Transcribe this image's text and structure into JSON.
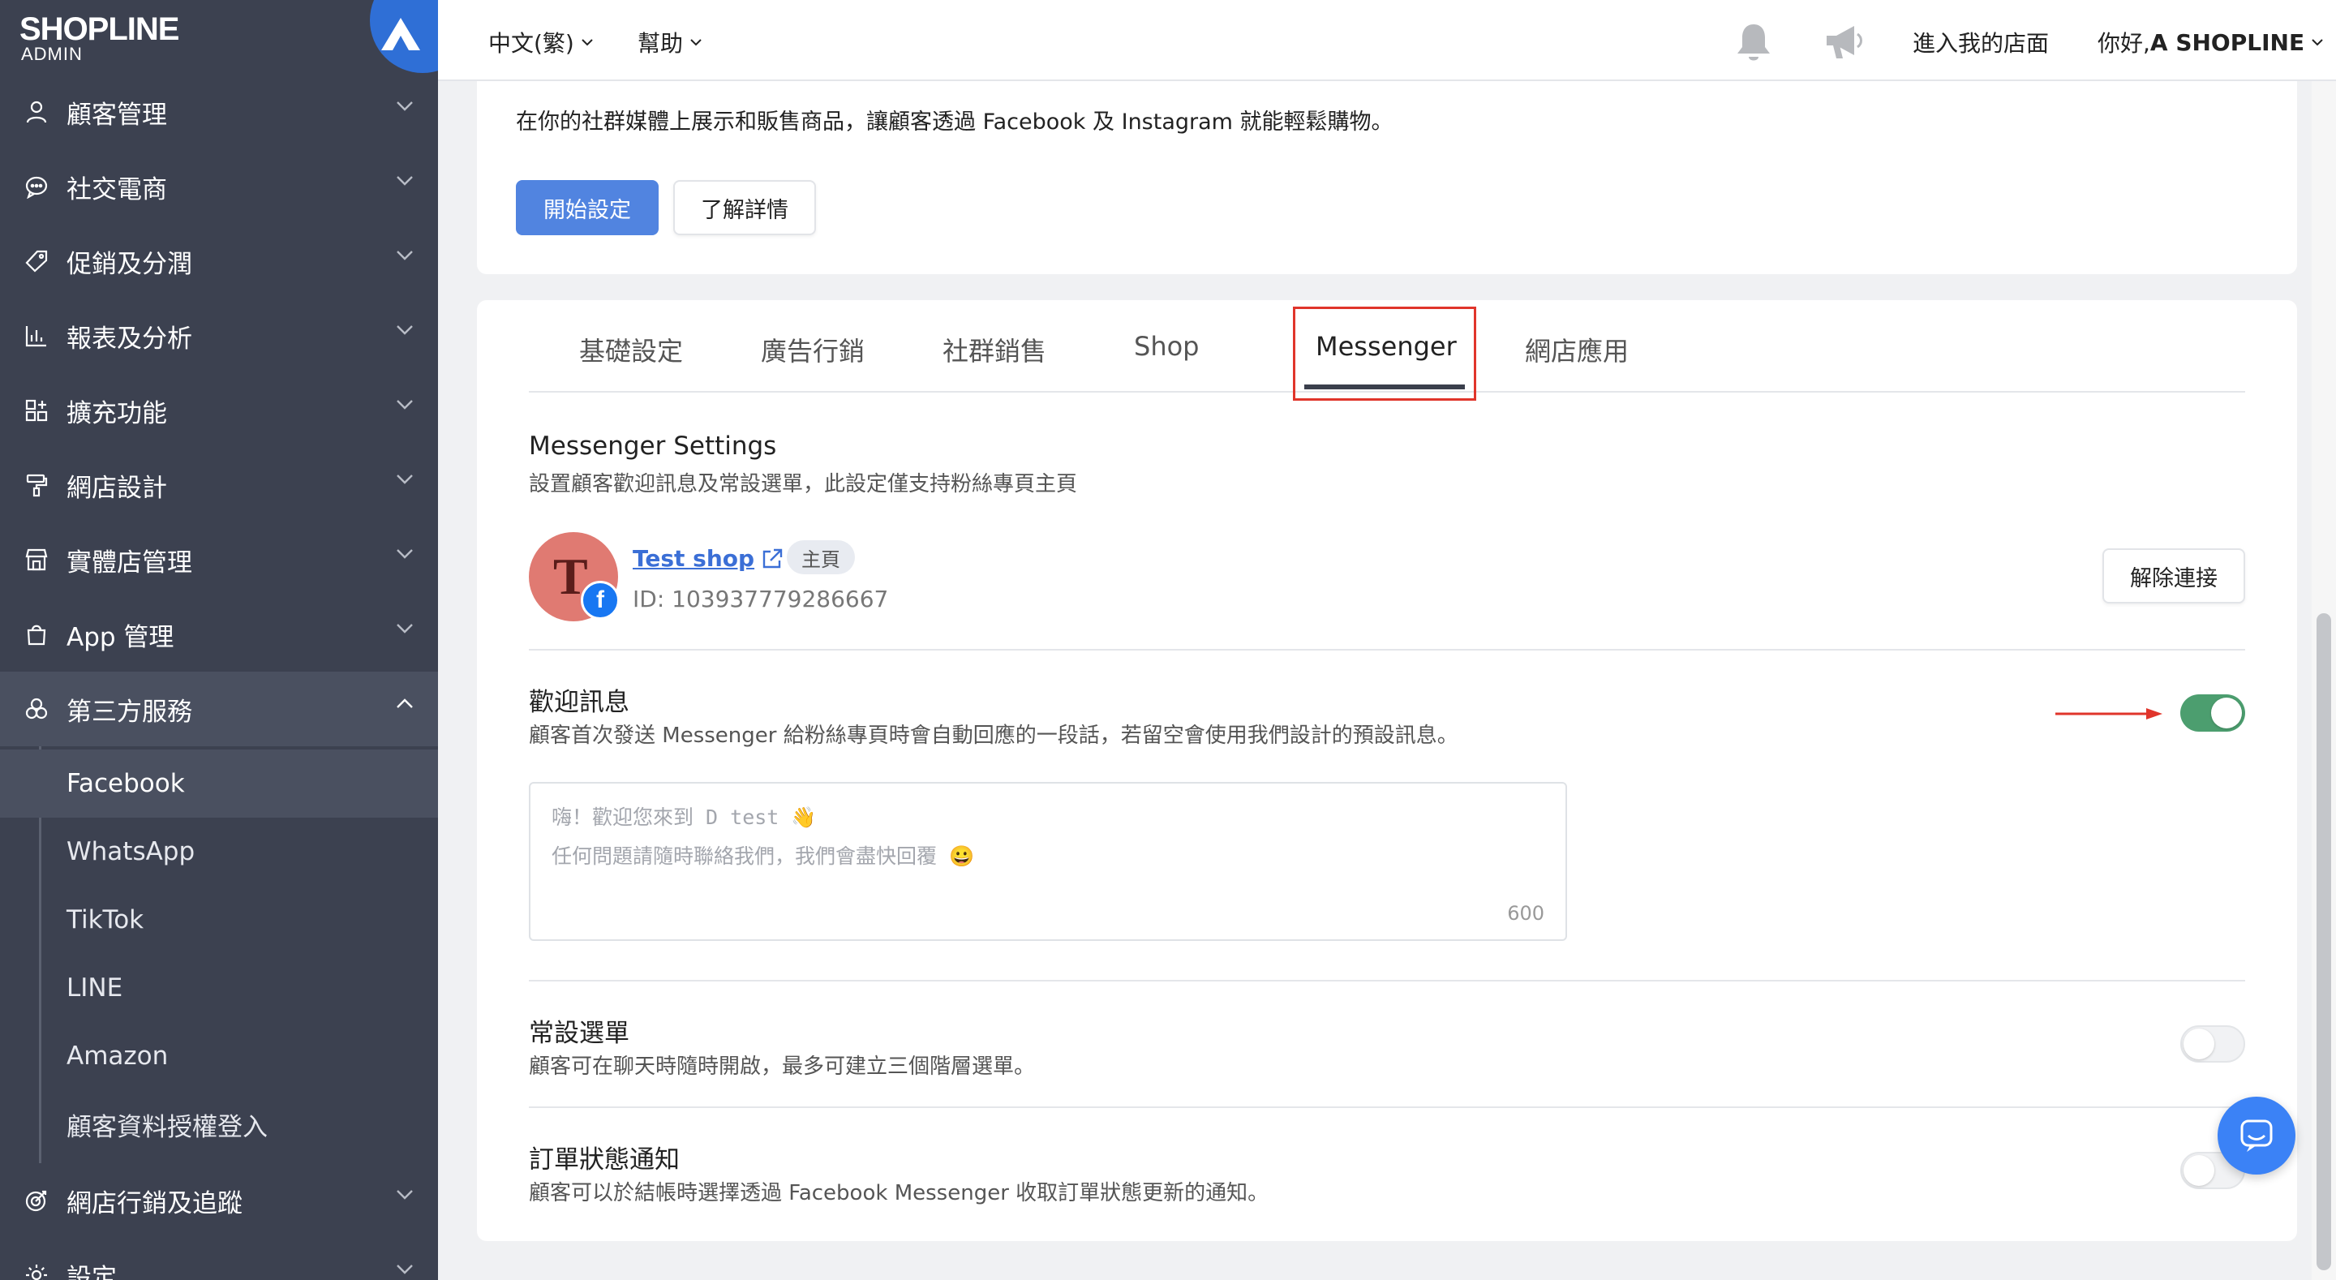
{
  "brand": {
    "name": "SHOPLINE",
    "sub": "ADMIN",
    "accent": "#2f6fd6"
  },
  "sidebar": {
    "items": [
      {
        "label": "顧客管理",
        "icon": "user-icon"
      },
      {
        "label": "社交電商",
        "icon": "chat-bubble-icon"
      },
      {
        "label": "促銷及分潤",
        "icon": "tag-icon"
      },
      {
        "label": "報表及分析",
        "icon": "bar-chart-icon"
      },
      {
        "label": "擴充功能",
        "icon": "grid-plus-icon"
      },
      {
        "label": "網店設計",
        "icon": "paint-roller-icon"
      },
      {
        "label": "實體店管理",
        "icon": "store-icon"
      },
      {
        "label": "App 管理",
        "icon": "shopping-bag-icon"
      },
      {
        "label": "第三方服務",
        "icon": "circles-icon"
      }
    ],
    "sub_items": [
      "Facebook",
      "WhatsApp",
      "TikTok",
      "LINE",
      "Amazon",
      "顧客資料授權登入"
    ],
    "bottom_items": [
      {
        "label": "網店行銷及追蹤",
        "icon": "target-icon"
      },
      {
        "label": "設定",
        "icon": "gear-icon"
      }
    ]
  },
  "topbar": {
    "language": "中文(繁)",
    "help": "幫助",
    "store_link": "進入我的店面",
    "greeting_prefix": "你好, ",
    "greeting_name": "A SHOPLINE"
  },
  "intro": {
    "text": "在你的社群媒體上展示和販售商品，讓顧客透過 Facebook 及 Instagram 就能輕鬆購物。",
    "start_button": "開始設定",
    "learn_button": "了解詳情"
  },
  "tabs": [
    "基礎設定",
    "廣告行銷",
    "社群銷售",
    "Shop",
    "Messenger",
    "網店應用"
  ],
  "active_tab": "Messenger",
  "messenger": {
    "title": "Messenger Settings",
    "desc": "設置顧客歡迎訊息及常設選單，此設定僅支持粉絲專頁主頁",
    "page_letter": "T",
    "page_name": "Test shop",
    "page_badge": "主頁",
    "page_id": "ID: 103937779286667",
    "disconnect": "解除連接"
  },
  "welcome": {
    "title": "歡迎訊息",
    "desc": "顧客首次發送 Messenger 給粉絲專頁時會自動回應的一段話，若留空會使用我們設計的預設訊息。",
    "enabled": true,
    "placeholder_line1": "嗨！歡迎您來到 D test 👋",
    "placeholder_line2": "任何問題請隨時聯絡我們，我們會盡快回覆 😀",
    "char_limit": "600"
  },
  "menu": {
    "title": "常設選單",
    "desc": "顧客可在聊天時隨時開啟，最多可建立三個階層選單。",
    "enabled": false
  },
  "order_notify": {
    "title": "訂單狀態通知",
    "desc": "顧客可以於結帳時選擇透過 Facebook Messenger 收取訂單狀態更新的通知。",
    "enabled": false
  }
}
